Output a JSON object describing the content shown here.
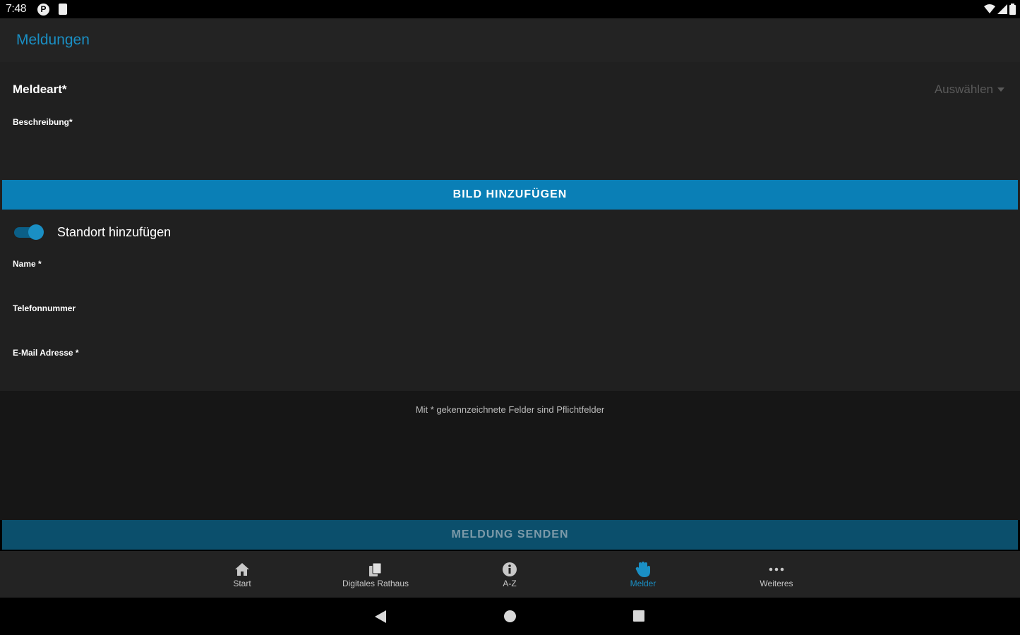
{
  "status_bar": {
    "time": "7:48"
  },
  "app_bar": {
    "title": "Meldungen"
  },
  "form": {
    "meldeart_label": "Meldeart*",
    "meldeart_select": "Auswählen",
    "beschreibung_label": "Beschreibung*",
    "add_image_button": "BILD HINZUFÜGEN",
    "location_toggle_label": "Standort hinzufügen",
    "location_toggle_on": true,
    "name_label": "Name *",
    "phone_label": "Telefonnummer",
    "email_label": "E-Mail Adresse *"
  },
  "info": {
    "required_note": "Mit * gekennzeichnete Felder sind Pflichtfelder"
  },
  "send_button": "MELDUNG SENDEN",
  "bottom_nav": {
    "items": [
      {
        "label": "Start",
        "icon": "home-icon"
      },
      {
        "label": "Digitales Rathaus",
        "icon": "documents-icon"
      },
      {
        "label": "A-Z",
        "icon": "info-icon"
      },
      {
        "label": "Melder",
        "icon": "hand-icon",
        "active": true
      },
      {
        "label": "Weiteres",
        "icon": "more-icon"
      }
    ]
  },
  "colors": {
    "accent": "#1a8fc4",
    "button_primary": "#0a7fb6",
    "button_disabled": "#0b4f6c",
    "background": "#202020"
  }
}
